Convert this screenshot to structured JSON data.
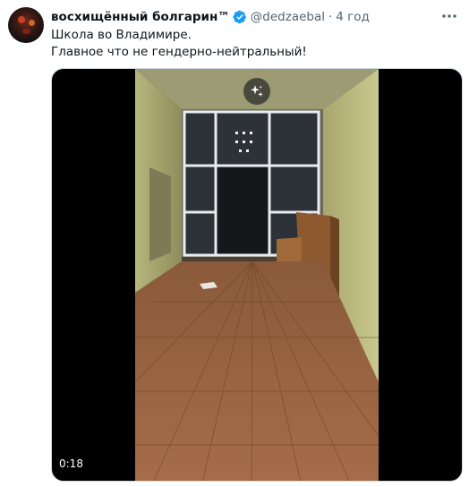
{
  "tweet": {
    "display_name": "восхищённый болгарин™",
    "handle": "@dedzaebal",
    "separator": "·",
    "time": "4 год",
    "text_lines": [
      "Школа во Владимире.",
      "Главное что не гендерно-нейтральный!"
    ]
  },
  "media": {
    "timestamp": "0:18"
  },
  "icons": {
    "verified": "verified-badge-icon",
    "more": "more-dots-icon",
    "grok": "sparkle-icon"
  },
  "colors": {
    "verified": "#1d9bf0",
    "secondary_text": "#536471",
    "primary_text": "#0f1419"
  }
}
